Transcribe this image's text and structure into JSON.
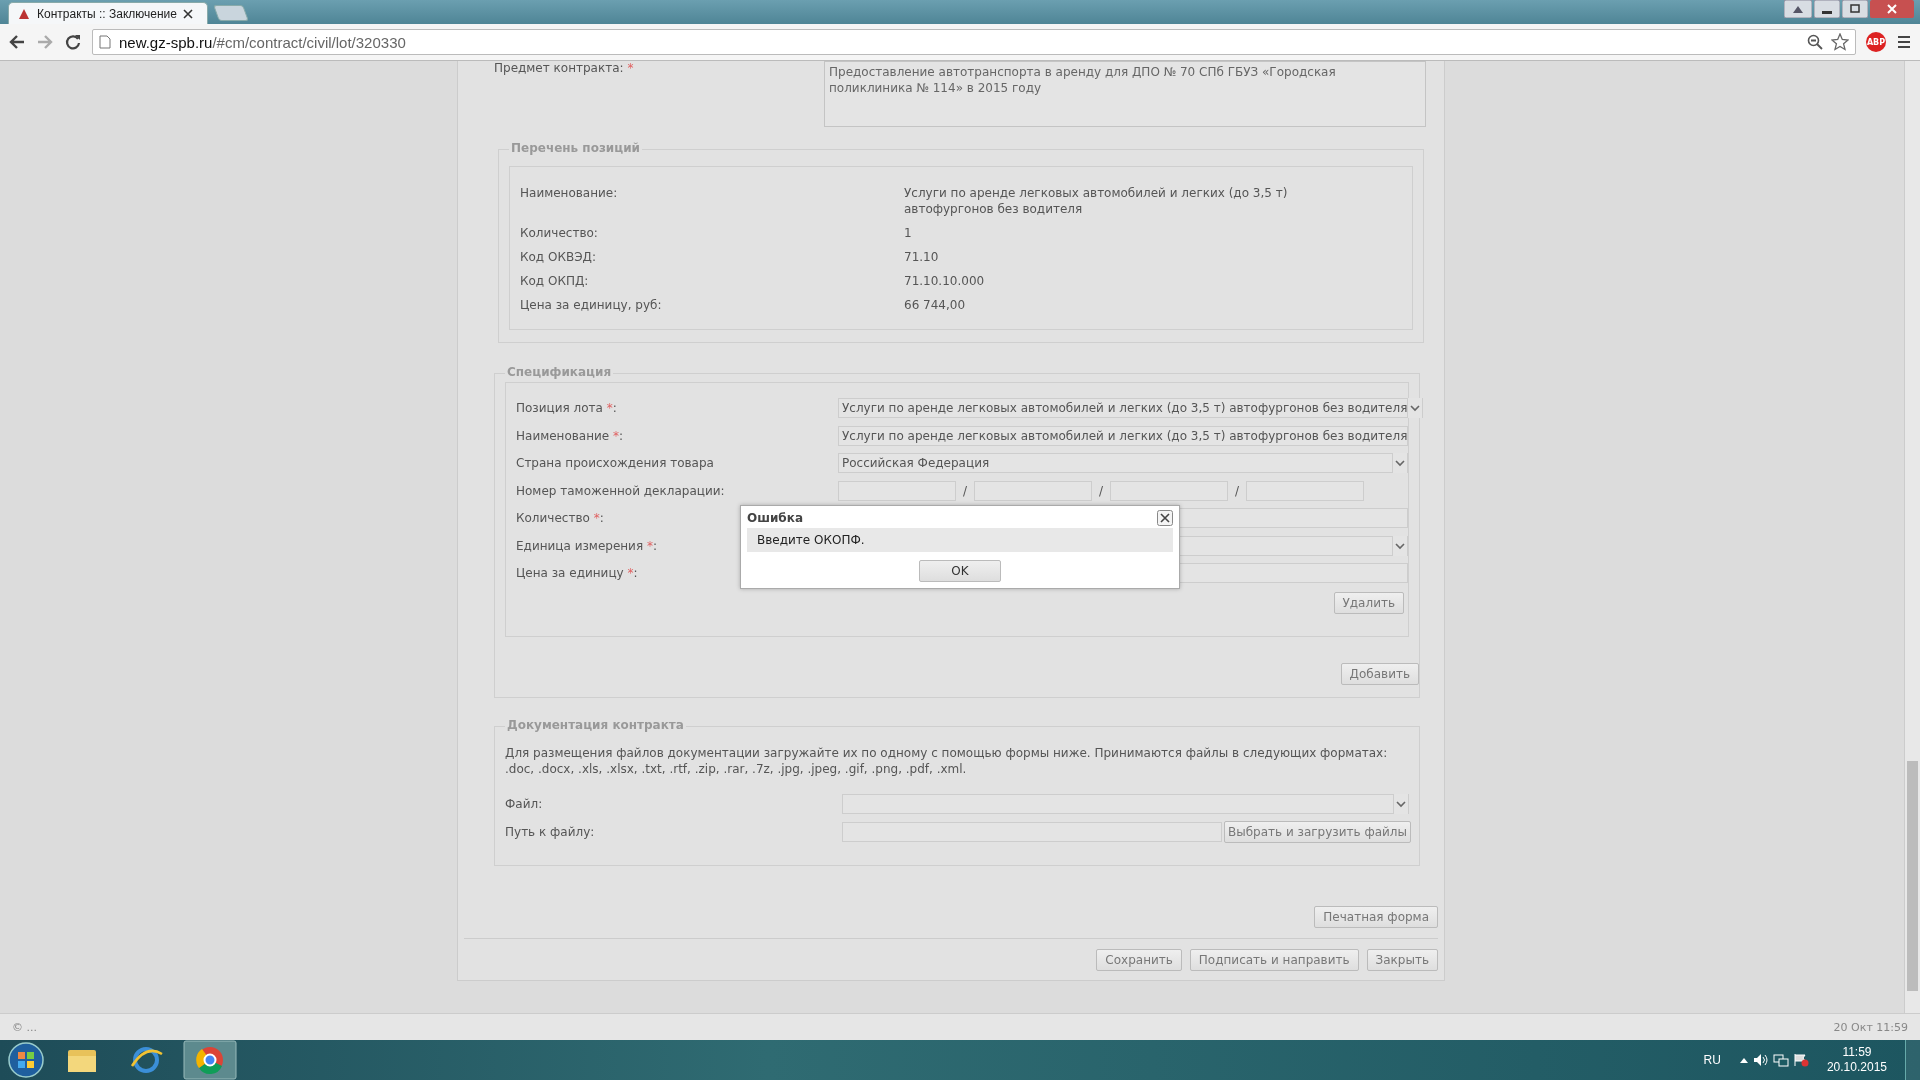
{
  "browser": {
    "tabs": [
      {
        "title": "Контракты :: Заключение",
        "selected": true
      }
    ],
    "address": {
      "host": "new.gz-spb.ru",
      "path": "/#cm/contract/civil/lot/320330"
    },
    "extension_badge": "ABP"
  },
  "subject": {
    "label": "Предмет контракта:",
    "required_mark": "*",
    "value": "Предоставление автотранспорта в аренду для ДПО № 70 СПб ГБУЗ «Городская поликлиника № 114» в 2015 году"
  },
  "positions": {
    "title": "Перечень позиций",
    "rows": [
      {
        "label": "Наименование:",
        "value": "Услуги по аренде легковых автомобилей и легких (до 3,5 т) автофургонов без водителя"
      },
      {
        "label": "Количество:",
        "value": "1"
      },
      {
        "label": "Код ОКВЭД:",
        "value": "71.10"
      },
      {
        "label": "Код ОКПД:",
        "value": "71.10.10.000"
      },
      {
        "label": "Цена за единицу, руб:",
        "value": "66 744,00"
      }
    ]
  },
  "specification": {
    "title": "Спецификация",
    "fields": [
      {
        "kind": "select",
        "label": "Позиция лота",
        "required_mark": "*",
        "label_end": ":",
        "value": "Услуги по аренде легковых автомобилей и легких (до 3,5 т) автофургонов без водителя"
      },
      {
        "kind": "text",
        "label": "Наименование",
        "required_mark": "*",
        "label_end": ":",
        "value": "Услуги по аренде легковых автомобилей и легких (до 3,5 т) автофургонов без водителя"
      },
      {
        "kind": "select",
        "label": "Страна происхождения товара",
        "value": "Российская Федерация"
      },
      {
        "kind": "customs",
        "label": "Номер таможенной декларации:",
        "separators": [
          "/",
          "/",
          "/"
        ]
      },
      {
        "kind": "text",
        "label": "Количество",
        "required_mark": "*",
        "label_end": ":"
      },
      {
        "kind": "select",
        "label": "Единица измерения",
        "required_mark": "*",
        "label_end": ":"
      },
      {
        "kind": "text",
        "label": "Цена за единицу",
        "required_mark": "*",
        "label_end": ":"
      }
    ],
    "delete_button": "Удалить",
    "add_button": "Добавить"
  },
  "documents": {
    "title": "Документация контракта",
    "note": "Для размещения файлов документации загружайте их по одному с помощью формы ниже. Принимаются файлы в следующих форматах: .doc, .docx, .xls, .xlsx, .txt, .rtf, .zip, .rar, .7z, .jpg, .jpeg, .gif, .png, .pdf, .xml.",
    "file_label": "Файл:",
    "path_label": "Путь к файлу:",
    "upload_button": "Выбрать и загрузить файлы"
  },
  "print_button": "Печатная форма",
  "actions": [
    "Сохранить",
    "Подписать и направить",
    "Закрыть"
  ],
  "dialog": {
    "title": "Ошибка",
    "message": "Введите ОКОПФ.",
    "button": "OK"
  },
  "status_bar": {
    "left": "© ...",
    "right": "20 Окт 11:59"
  },
  "taskbar": {
    "language": "RU",
    "time": "11:59",
    "date": "20.10.2015"
  }
}
